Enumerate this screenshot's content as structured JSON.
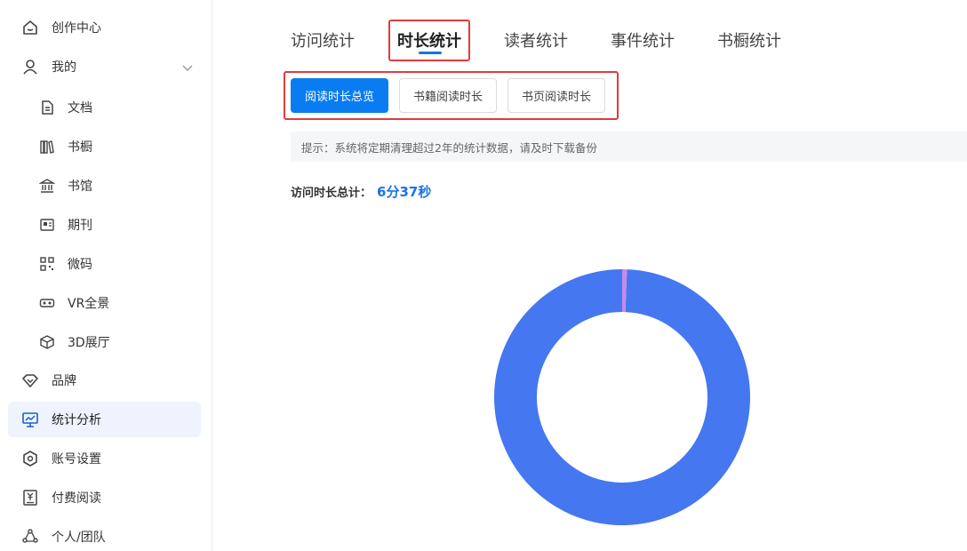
{
  "sidebar": {
    "items": [
      {
        "label": "创作中心",
        "icon": "home-icon"
      },
      {
        "label": "我的",
        "icon": "user-icon"
      },
      {
        "label": "文档",
        "icon": "document-icon"
      },
      {
        "label": "书橱",
        "icon": "bookshelf-icon"
      },
      {
        "label": "书馆",
        "icon": "library-icon"
      },
      {
        "label": "期刊",
        "icon": "journal-icon"
      },
      {
        "label": "微码",
        "icon": "qrcode-icon"
      },
      {
        "label": "VR全景",
        "icon": "vr-icon"
      },
      {
        "label": "3D展厅",
        "icon": "cube-icon"
      },
      {
        "label": "品牌",
        "icon": "diamond-icon"
      },
      {
        "label": "统计分析",
        "icon": "chart-icon"
      },
      {
        "label": "账号设置",
        "icon": "settings-icon"
      },
      {
        "label": "付费阅读",
        "icon": "payment-icon"
      },
      {
        "label": "个人/团队",
        "icon": "team-icon"
      }
    ],
    "active_item": "统计分析"
  },
  "tabs": [
    "访问统计",
    "时长统计",
    "读者统计",
    "事件统计",
    "书橱统计"
  ],
  "active_tab": "时长统计",
  "sub_tabs": [
    "阅读时长总览",
    "书籍阅读时长",
    "书页阅读时长"
  ],
  "active_sub_tab": "阅读时长总览",
  "notice": "提示：系统将定期清理超过2年的统计数据，请及时下载备份",
  "total": {
    "label": "访问时长总计：",
    "value": "6分37秒"
  },
  "colors": {
    "primary": "#0a7cf2",
    "highlight": "#e03b3b",
    "donut_main": "#4577f0",
    "donut_minor": "#c48be8"
  },
  "chart_data": {
    "type": "pie",
    "donut": true,
    "values": [
      99.4,
      0.6
    ]
  }
}
